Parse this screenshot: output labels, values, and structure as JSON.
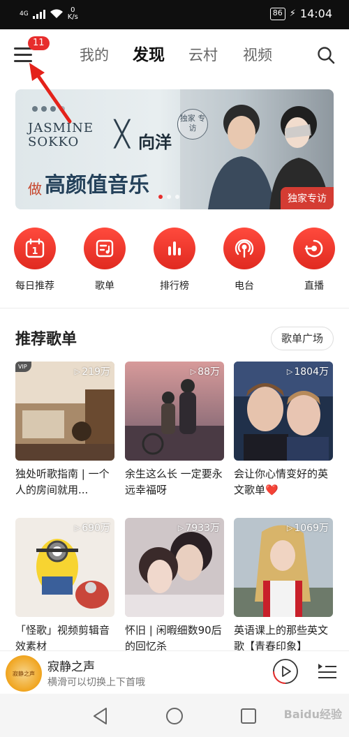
{
  "status_bar": {
    "network": "4G",
    "speed_value": "0",
    "speed_unit": "K/s",
    "battery": "86",
    "time": "14:04"
  },
  "header": {
    "menu_badge": "11",
    "tabs": [
      {
        "label": "我的",
        "active": false
      },
      {
        "label": "发现",
        "active": true
      },
      {
        "label": "云村",
        "active": false
      },
      {
        "label": "视频",
        "active": false
      }
    ]
  },
  "banner": {
    "brand_line1": "JASMINE",
    "brand_line2": "SOKKO",
    "cross": "╳",
    "artist": "向洋",
    "circle_text": "独家 专访",
    "slogan_prefix": "做",
    "slogan_main": "高颜值音乐",
    "tag": "独家专访"
  },
  "quick_nav": [
    {
      "label": "每日推荐",
      "icon": "calendar-icon",
      "day": "1"
    },
    {
      "label": "歌单",
      "icon": "playlist-icon"
    },
    {
      "label": "排行榜",
      "icon": "chart-bars-icon"
    },
    {
      "label": "电台",
      "icon": "radio-icon"
    },
    {
      "label": "直播",
      "icon": "live-icon"
    }
  ],
  "section": {
    "title": "推荐歌单",
    "more_button": "歌单广场"
  },
  "playlists": [
    {
      "title": "独处听歌指南 | 一个人的房间就用...",
      "count": "219万",
      "vip": true,
      "vip_label": "VIP"
    },
    {
      "title": "余生这么长 一定要永远幸福呀",
      "count": "88万"
    },
    {
      "title": "会让你心情变好的英文歌单❤️",
      "count": "1804万"
    },
    {
      "title": "「怪歌」视频剪辑音效素材",
      "count": "690万"
    },
    {
      "title": "怀旧 | 闲暇细数90后的回忆杀",
      "count": "7933万"
    },
    {
      "title": "英语课上的那些英文歌【青春印象】",
      "count": "1069万"
    }
  ],
  "player": {
    "title": "寂静之声",
    "subtitle": "横滑可以切换上下首哦",
    "avatar_text": "寂静之声"
  },
  "watermark": "Baidu经验",
  "colors": {
    "accent": "#e72d2c",
    "status_bar": "#0f0f0f"
  }
}
